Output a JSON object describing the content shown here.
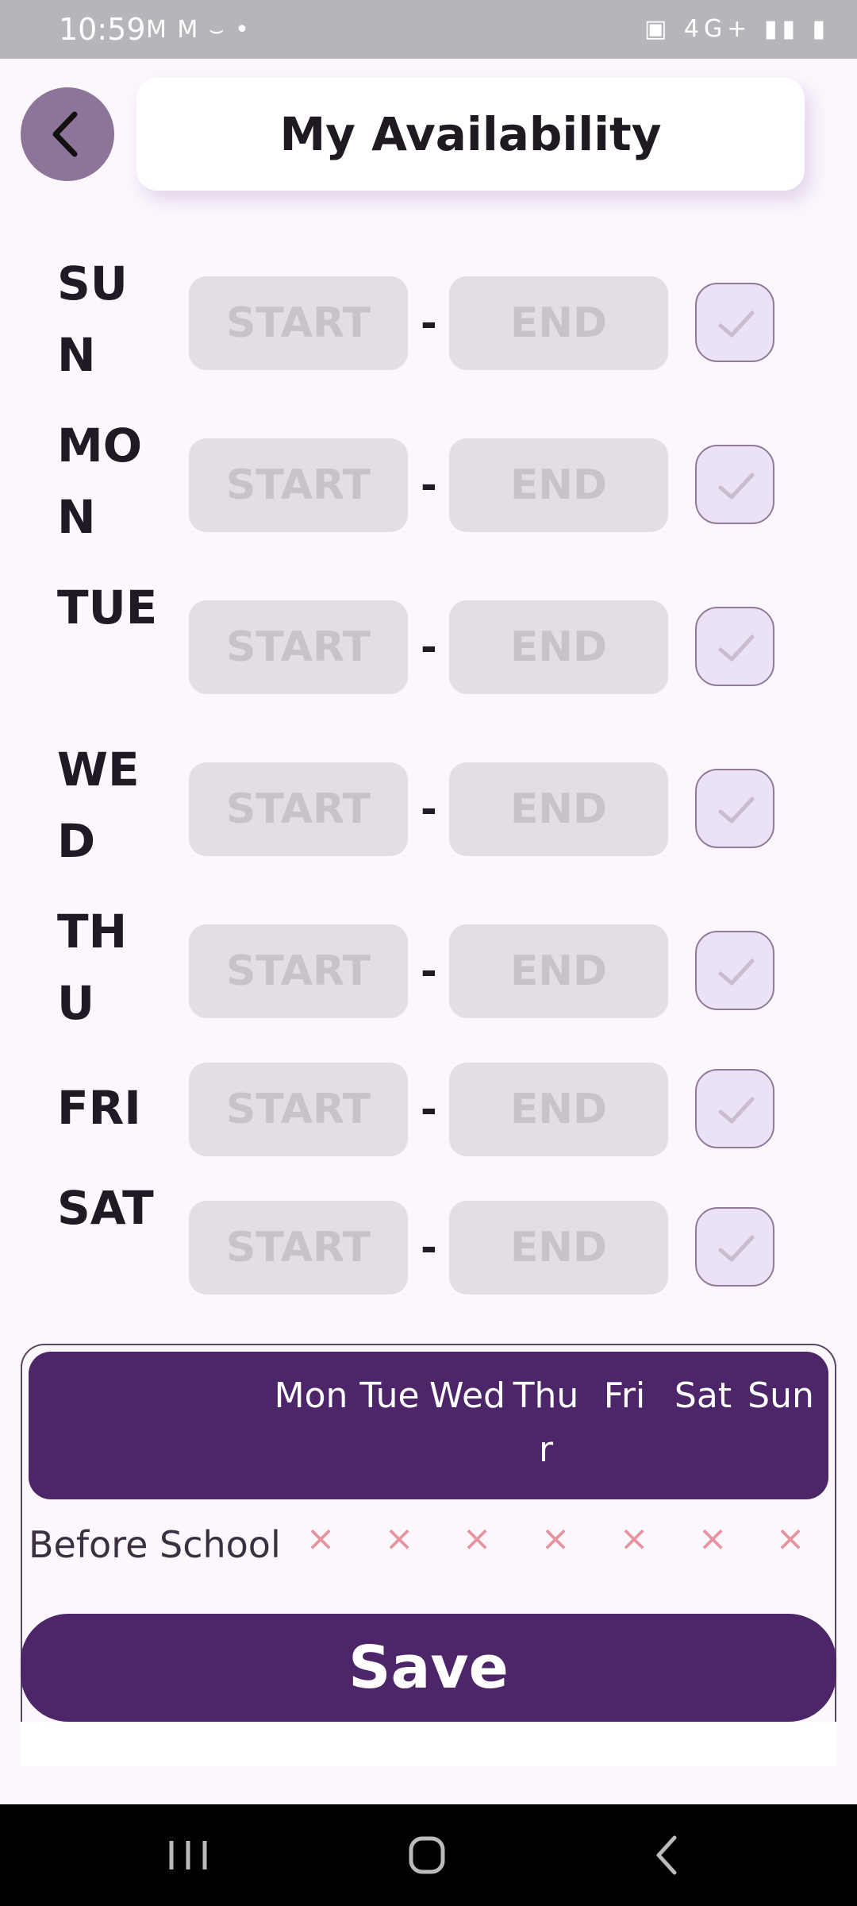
{
  "status_bar": {
    "time": "10:59",
    "notification_icons": "M M ⌣ •",
    "system_icons": "▣ 4G+ ▮▮ ▮"
  },
  "header": {
    "title": "My Availability",
    "back_icon": "chevron-left-icon"
  },
  "days": [
    {
      "label": "SUN",
      "start_placeholder": "START",
      "separator": "-",
      "end_placeholder": "END",
      "checked": false
    },
    {
      "label": "MON",
      "start_placeholder": "START",
      "separator": "-",
      "end_placeholder": "END",
      "checked": false
    },
    {
      "label": "TUE",
      "start_placeholder": "START",
      "separator": "-",
      "end_placeholder": "END",
      "checked": false
    },
    {
      "label": "WED",
      "start_placeholder": "START",
      "separator": "-",
      "end_placeholder": "END",
      "checked": false
    },
    {
      "label": "THU",
      "start_placeholder": "START",
      "separator": "-",
      "end_placeholder": "END",
      "checked": false
    },
    {
      "label": "FRI",
      "start_placeholder": "START",
      "separator": "-",
      "end_placeholder": "END",
      "checked": false
    },
    {
      "label": "SAT",
      "start_placeholder": "START",
      "separator": "-",
      "end_placeholder": "END",
      "checked": false
    }
  ],
  "schedule_table": {
    "columns": [
      "Mon",
      "Tue",
      "Wed",
      "Thur",
      "Fri",
      "Sat",
      "Sun"
    ],
    "rows": [
      {
        "label": "Before School",
        "cells": [
          "×",
          "×",
          "×",
          "×",
          "×",
          "×",
          "×"
        ]
      }
    ]
  },
  "save_button": {
    "label": "Save"
  },
  "colors": {
    "accent": "#4d2569",
    "back_button": "#8d7599",
    "background": "#fcf6fd",
    "placeholder_box": "#e4dde5",
    "cross_mark": "#e8929d"
  }
}
